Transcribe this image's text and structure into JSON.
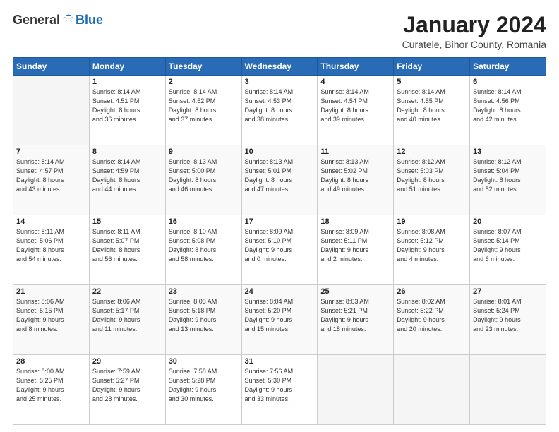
{
  "header": {
    "logo_general": "General",
    "logo_blue": "Blue",
    "title": "January 2024",
    "subtitle": "Curatele, Bihor County, Romania"
  },
  "days_of_week": [
    "Sunday",
    "Monday",
    "Tuesday",
    "Wednesday",
    "Thursday",
    "Friday",
    "Saturday"
  ],
  "weeks": [
    [
      {
        "day": "",
        "info": ""
      },
      {
        "day": "1",
        "info": "Sunrise: 8:14 AM\nSunset: 4:51 PM\nDaylight: 8 hours\nand 36 minutes."
      },
      {
        "day": "2",
        "info": "Sunrise: 8:14 AM\nSunset: 4:52 PM\nDaylight: 8 hours\nand 37 minutes."
      },
      {
        "day": "3",
        "info": "Sunrise: 8:14 AM\nSunset: 4:53 PM\nDaylight: 8 hours\nand 38 minutes."
      },
      {
        "day": "4",
        "info": "Sunrise: 8:14 AM\nSunset: 4:54 PM\nDaylight: 8 hours\nand 39 minutes."
      },
      {
        "day": "5",
        "info": "Sunrise: 8:14 AM\nSunset: 4:55 PM\nDaylight: 8 hours\nand 40 minutes."
      },
      {
        "day": "6",
        "info": "Sunrise: 8:14 AM\nSunset: 4:56 PM\nDaylight: 8 hours\nand 42 minutes."
      }
    ],
    [
      {
        "day": "7",
        "info": "Sunrise: 8:14 AM\nSunset: 4:57 PM\nDaylight: 8 hours\nand 43 minutes."
      },
      {
        "day": "8",
        "info": "Sunrise: 8:14 AM\nSunset: 4:59 PM\nDaylight: 8 hours\nand 44 minutes."
      },
      {
        "day": "9",
        "info": "Sunrise: 8:13 AM\nSunset: 5:00 PM\nDaylight: 8 hours\nand 46 minutes."
      },
      {
        "day": "10",
        "info": "Sunrise: 8:13 AM\nSunset: 5:01 PM\nDaylight: 8 hours\nand 47 minutes."
      },
      {
        "day": "11",
        "info": "Sunrise: 8:13 AM\nSunset: 5:02 PM\nDaylight: 8 hours\nand 49 minutes."
      },
      {
        "day": "12",
        "info": "Sunrise: 8:12 AM\nSunset: 5:03 PM\nDaylight: 8 hours\nand 51 minutes."
      },
      {
        "day": "13",
        "info": "Sunrise: 8:12 AM\nSunset: 5:04 PM\nDaylight: 8 hours\nand 52 minutes."
      }
    ],
    [
      {
        "day": "14",
        "info": "Sunrise: 8:11 AM\nSunset: 5:06 PM\nDaylight: 8 hours\nand 54 minutes."
      },
      {
        "day": "15",
        "info": "Sunrise: 8:11 AM\nSunset: 5:07 PM\nDaylight: 8 hours\nand 56 minutes."
      },
      {
        "day": "16",
        "info": "Sunrise: 8:10 AM\nSunset: 5:08 PM\nDaylight: 8 hours\nand 58 minutes."
      },
      {
        "day": "17",
        "info": "Sunrise: 8:09 AM\nSunset: 5:10 PM\nDaylight: 9 hours\nand 0 minutes."
      },
      {
        "day": "18",
        "info": "Sunrise: 8:09 AM\nSunset: 5:11 PM\nDaylight: 9 hours\nand 2 minutes."
      },
      {
        "day": "19",
        "info": "Sunrise: 8:08 AM\nSunset: 5:12 PM\nDaylight: 9 hours\nand 4 minutes."
      },
      {
        "day": "20",
        "info": "Sunrise: 8:07 AM\nSunset: 5:14 PM\nDaylight: 9 hours\nand 6 minutes."
      }
    ],
    [
      {
        "day": "21",
        "info": "Sunrise: 8:06 AM\nSunset: 5:15 PM\nDaylight: 9 hours\nand 8 minutes."
      },
      {
        "day": "22",
        "info": "Sunrise: 8:06 AM\nSunset: 5:17 PM\nDaylight: 9 hours\nand 11 minutes."
      },
      {
        "day": "23",
        "info": "Sunrise: 8:05 AM\nSunset: 5:18 PM\nDaylight: 9 hours\nand 13 minutes."
      },
      {
        "day": "24",
        "info": "Sunrise: 8:04 AM\nSunset: 5:20 PM\nDaylight: 9 hours\nand 15 minutes."
      },
      {
        "day": "25",
        "info": "Sunrise: 8:03 AM\nSunset: 5:21 PM\nDaylight: 9 hours\nand 18 minutes."
      },
      {
        "day": "26",
        "info": "Sunrise: 8:02 AM\nSunset: 5:22 PM\nDaylight: 9 hours\nand 20 minutes."
      },
      {
        "day": "27",
        "info": "Sunrise: 8:01 AM\nSunset: 5:24 PM\nDaylight: 9 hours\nand 23 minutes."
      }
    ],
    [
      {
        "day": "28",
        "info": "Sunrise: 8:00 AM\nSunset: 5:25 PM\nDaylight: 9 hours\nand 25 minutes."
      },
      {
        "day": "29",
        "info": "Sunrise: 7:59 AM\nSunset: 5:27 PM\nDaylight: 9 hours\nand 28 minutes."
      },
      {
        "day": "30",
        "info": "Sunrise: 7:58 AM\nSunset: 5:28 PM\nDaylight: 9 hours\nand 30 minutes."
      },
      {
        "day": "31",
        "info": "Sunrise: 7:56 AM\nSunset: 5:30 PM\nDaylight: 9 hours\nand 33 minutes."
      },
      {
        "day": "",
        "info": ""
      },
      {
        "day": "",
        "info": ""
      },
      {
        "day": "",
        "info": ""
      }
    ]
  ]
}
